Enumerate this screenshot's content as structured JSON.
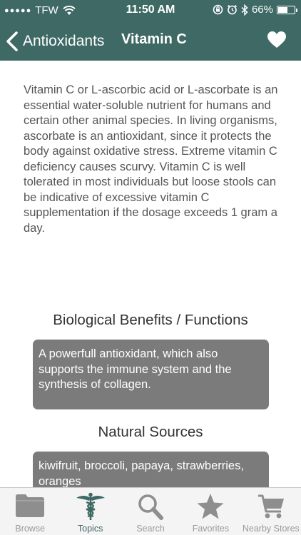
{
  "status_bar": {
    "signal_dots": "●●●●●",
    "carrier": "TFW",
    "time": "11:50 AM",
    "battery_percent": "66%",
    "battery_level": 0.66
  },
  "nav": {
    "back_label": "Antioxidants",
    "title": "Vitamin C"
  },
  "description": "Vitamin C or L-ascorbic acid or L-ascorbate is an essential water-soluble nutrient for humans and certain other animal species. In living organisms, ascorbate is an antioxidant, since it protects the body against oxidative stress. Extreme vitamin C deficiency causes scurvy. Vitamin C is well tolerated in most individuals but loose stools can be indicative of excessive vitamin C supplementation if the dosage exceeds 1 gram a day.",
  "sections": [
    {
      "title": "Biological Benefits / Functions",
      "body": "A powerfull antioxidant, which also supports the immune system and the synthesis of collagen."
    },
    {
      "title": "Natural Sources",
      "body": "kiwifruit, broccoli, papaya, strawberries, oranges"
    }
  ],
  "tabs": [
    {
      "label": "Browse",
      "icon": "folder-icon"
    },
    {
      "label": "Topics",
      "icon": "caduceus-icon"
    },
    {
      "label": "Search",
      "icon": "search-icon"
    },
    {
      "label": "Favorites",
      "icon": "star-icon"
    },
    {
      "label": "Nearby Stores",
      "icon": "cart-icon"
    }
  ],
  "active_tab": "Topics",
  "colors": {
    "header": "#3e6965",
    "section_box": "#7b7b7b",
    "tab_inactive": "#9a9a9a",
    "tab_active": "#3e6965"
  }
}
